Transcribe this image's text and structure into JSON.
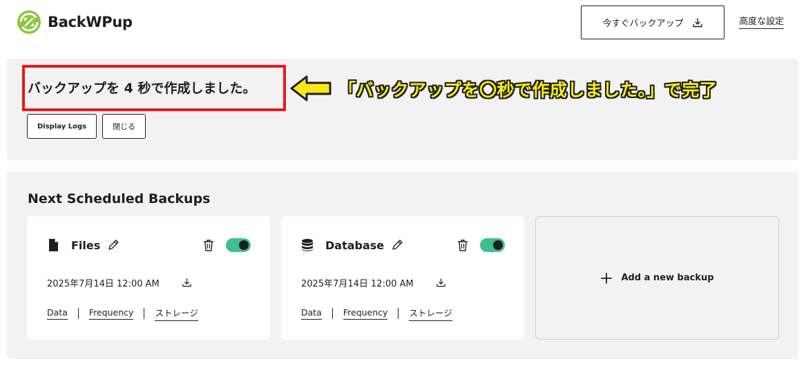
{
  "header": {
    "app_name": "BackWPup",
    "backup_now_label": "今すぐバックアップ",
    "advanced_settings_label": "高度な設定"
  },
  "notice": {
    "message": "バックアップを 4 秒で作成しました。",
    "display_logs_label": "Display Logs",
    "close_label": "閉じる",
    "annotation_text": "「バックアップを〇秒で作成しました。」で完了"
  },
  "scheduled": {
    "title": "Next Scheduled Backups",
    "cards": [
      {
        "title": "Files",
        "icon": "file-icon",
        "date": "2025年7月14日 12:00 AM",
        "enabled": true,
        "links": [
          "Data",
          "Frequency",
          "ストレージ"
        ]
      },
      {
        "title": "Database",
        "icon": "database-icon",
        "date": "2025年7月14日 12:00 AM",
        "enabled": true,
        "links": [
          "Data",
          "Frequency",
          "ストレージ"
        ]
      }
    ],
    "add_backup_label": "Add a new backup"
  },
  "colors": {
    "accent_green": "#3dbf8e",
    "logo_green": "#8cc63f",
    "highlight_red": "#e8171c",
    "annotation_yellow": "#f5e91a",
    "panel_gray": "#f2f2f2"
  }
}
